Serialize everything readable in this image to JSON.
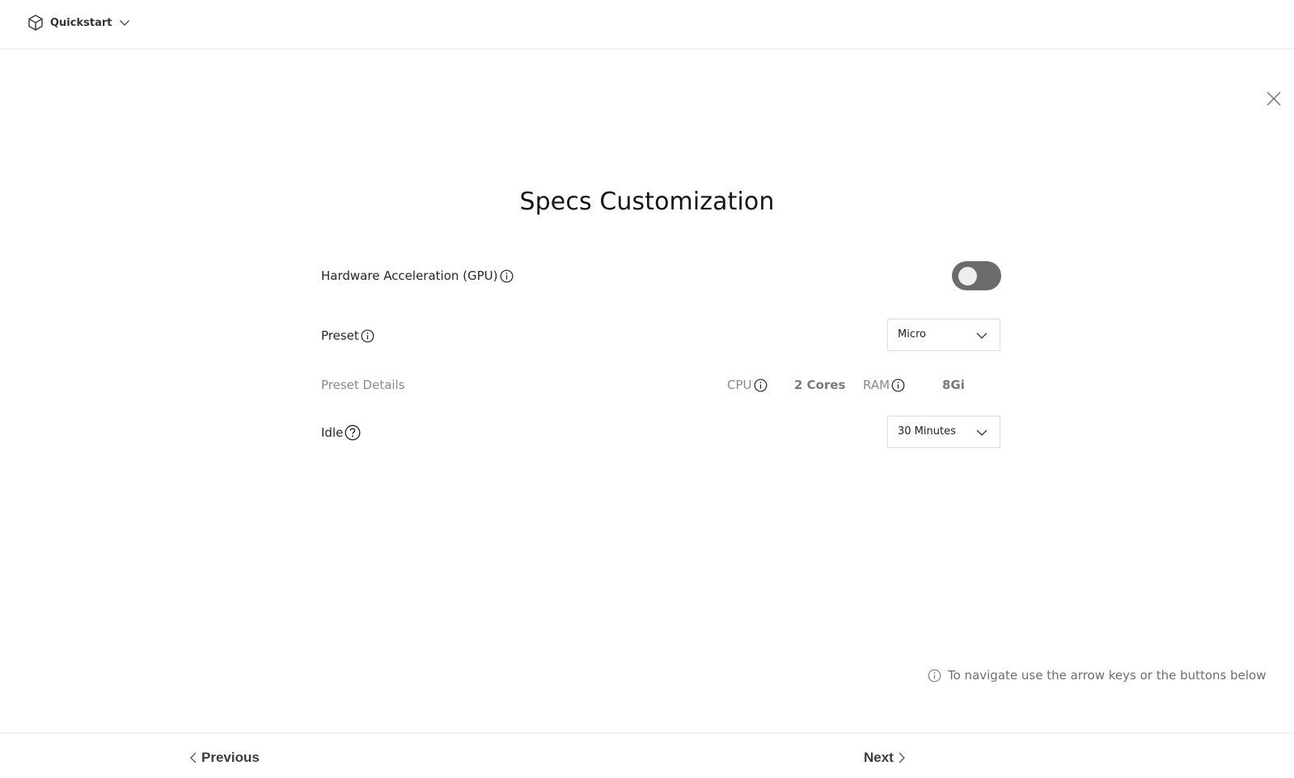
{
  "topbar": {
    "project_name": "Quickstart",
    "project_icon": "cube-icon",
    "dropdown_icon": "chevron-down-icon"
  },
  "dialog": {
    "close_icon": "close-icon",
    "title": "Specs Customization"
  },
  "form": {
    "gpu": {
      "label": "Hardware Acceleration (GPU)",
      "info_icon": "info-icon",
      "enabled": false
    },
    "preset": {
      "label": "Preset",
      "info_icon": "info-icon",
      "selected": "Micro"
    },
    "preset_details": {
      "label": "Preset Details",
      "cpu_label": "CPU",
      "cpu_value": "2 Cores",
      "ram_label": "RAM",
      "ram_value": "8Gi"
    },
    "idle": {
      "label": "Idle",
      "help_icon": "question-icon",
      "selected": "30 Minutes"
    }
  },
  "hint": {
    "icon": "info-icon",
    "text": "To navigate use the arrow keys or the buttons below"
  },
  "footer": {
    "previous_label": "Previous",
    "next_label": "Next"
  },
  "colors": {
    "toggle_off": "#6b6b6b",
    "toggle_knob": "#eeeeee",
    "muted_text": "#8a8a8a",
    "border": "#dcdcdc"
  }
}
